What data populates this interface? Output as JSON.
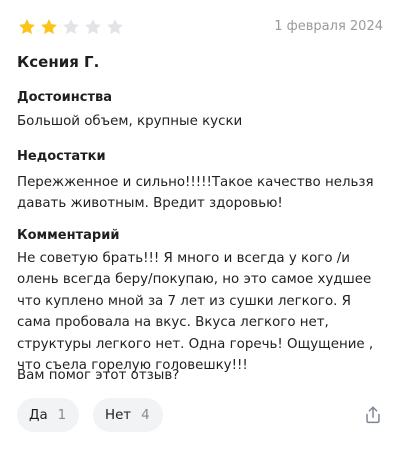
{
  "review": {
    "rating": {
      "value": 2,
      "max": 5,
      "filled_color": "#fcc419",
      "empty_color": "#e2e4e8"
    },
    "date": "1 февраля 2024",
    "author": "Ксения Г.",
    "pros": {
      "title": "Достоинства",
      "text": "Большой объем, крупные куски"
    },
    "cons": {
      "title": "Недостатки",
      "text": "Пережженное и сильно!!!!!Такое качество нельзя давать животным. Вредит здоровью!"
    },
    "comment": {
      "title": "Комментарий",
      "text": "Не советую брать!!! Я много и всегда у кого /и олень всегда беру/покупаю, но это самое худшее что куплено мной за 7 лет из сушки легкого. Я сама пробовала на вкус. Вкуса легкого нет, структуры легкого нет. Одна горечь! Ощущение , что съела горелую головешку!!!"
    },
    "helpful": {
      "question": "Вам помог этот отзыв?",
      "yes_label": "Да",
      "yes_count": "1",
      "no_label": "Нет",
      "no_count": "4"
    },
    "share_icon": "share-icon"
  }
}
